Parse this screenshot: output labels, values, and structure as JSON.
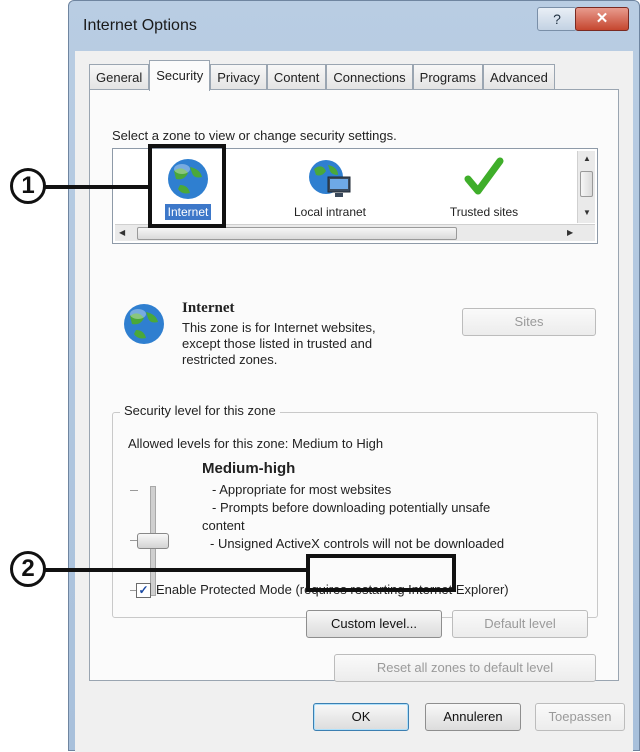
{
  "window": {
    "title": "Internet Options",
    "help_label": "?",
    "close_label": "✕"
  },
  "tabs": [
    {
      "label": "General"
    },
    {
      "label": "Security"
    },
    {
      "label": "Privacy"
    },
    {
      "label": "Content"
    },
    {
      "label": "Connections"
    },
    {
      "label": "Programs"
    },
    {
      "label": "Advanced"
    }
  ],
  "security": {
    "zone_prompt": "Select a zone to view or change security settings.",
    "zones": [
      {
        "label": "Internet",
        "icon": "globe-icon",
        "selected": true
      },
      {
        "label": "Local intranet",
        "icon": "local-intranet-icon"
      },
      {
        "label": "Trusted sites",
        "icon": "checkmark-icon"
      }
    ],
    "zone_title": "Internet",
    "zone_desc_1": "This zone is for Internet websites,",
    "zone_desc_2": "except those listed in trusted and",
    "zone_desc_3": "restricted zones.",
    "sites_button": "Sites",
    "level_group": "Security level for this zone",
    "allowed_levels": "Allowed levels for this zone: Medium to High",
    "level_name": "Medium-high",
    "level_desc_1": "- Appropriate for most websites",
    "level_desc_2": "- Prompts before downloading potentially unsafe",
    "level_desc_3": "content",
    "level_desc_4": "- Unsigned ActiveX controls will not be downloaded",
    "protected_mode": "Enable Protected Mode (requires restarting Internet Explorer)",
    "protected_mode_checked": "✓",
    "custom_level": "Custom level...",
    "default_level": "Default level",
    "reset_all": "Reset all zones to default level"
  },
  "footer": {
    "ok": "OK",
    "cancel": "Annuleren",
    "apply": "Toepassen"
  },
  "callouts": {
    "one": "1",
    "two": "2"
  },
  "colors": {
    "title_bar": "#b9cde3",
    "close": "#c5462f",
    "selection": "#3d78c9",
    "trusted_check": "#3fae2a"
  }
}
